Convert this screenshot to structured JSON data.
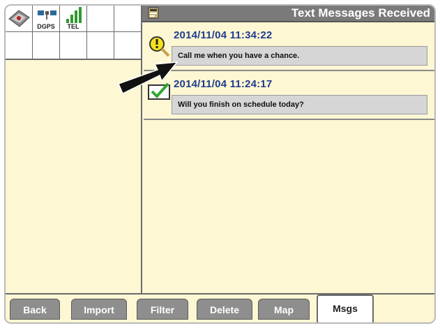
{
  "status_icons": [
    {
      "icon": "machine-icon",
      "label": ""
    },
    {
      "icon": "dgps-satellite-icon",
      "label": "DGPS"
    },
    {
      "icon": "tel-signal-icon",
      "label": "TEL"
    }
  ],
  "header": {
    "title": "Text Messages Received",
    "icon": "message-icon"
  },
  "messages": [
    {
      "timestamp": "2014/11/04 11:34:22",
      "text": "Call me when you have a chance.",
      "status_icon": "unread-alert-icon"
    },
    {
      "timestamp": "2014/11/04 11:24:17",
      "text": "Will you finish on schedule today?",
      "status_icon": "read-check-icon"
    }
  ],
  "tabs": [
    {
      "label": "Back"
    },
    {
      "label": "Import"
    },
    {
      "label": "Filter"
    },
    {
      "label": "Delete"
    },
    {
      "label": "Map"
    },
    {
      "label": "Msgs",
      "active": true
    }
  ],
  "colors": {
    "background": "#fdf7d4",
    "header_bg": "#7a7a7a",
    "timestamp": "#1f3c8c",
    "tab_bg": "#8e8e8e"
  }
}
